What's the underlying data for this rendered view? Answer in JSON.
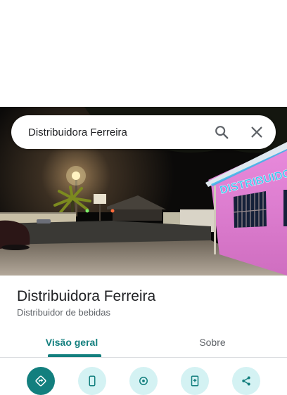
{
  "search": {
    "query": "Distribuidora Ferreira"
  },
  "photo": {
    "sign_text": "DISTRIBUIDORA"
  },
  "place": {
    "name": "Distribuidora Ferreira",
    "category": "Distribuidor de bebidas"
  },
  "tabs": [
    {
      "label": "Visão geral",
      "selected": true
    },
    {
      "label": "Sobre",
      "selected": false
    }
  ],
  "actions": [
    {
      "icon": "directions-icon"
    },
    {
      "icon": "phone-icon"
    },
    {
      "icon": "location-icon"
    },
    {
      "icon": "save-icon"
    },
    {
      "icon": "share-icon"
    }
  ],
  "colors": {
    "accent": "#137f7e",
    "action_bg": "#d4f2f3",
    "building": "#e07fd0",
    "sign_text": "#3ec6f0"
  }
}
